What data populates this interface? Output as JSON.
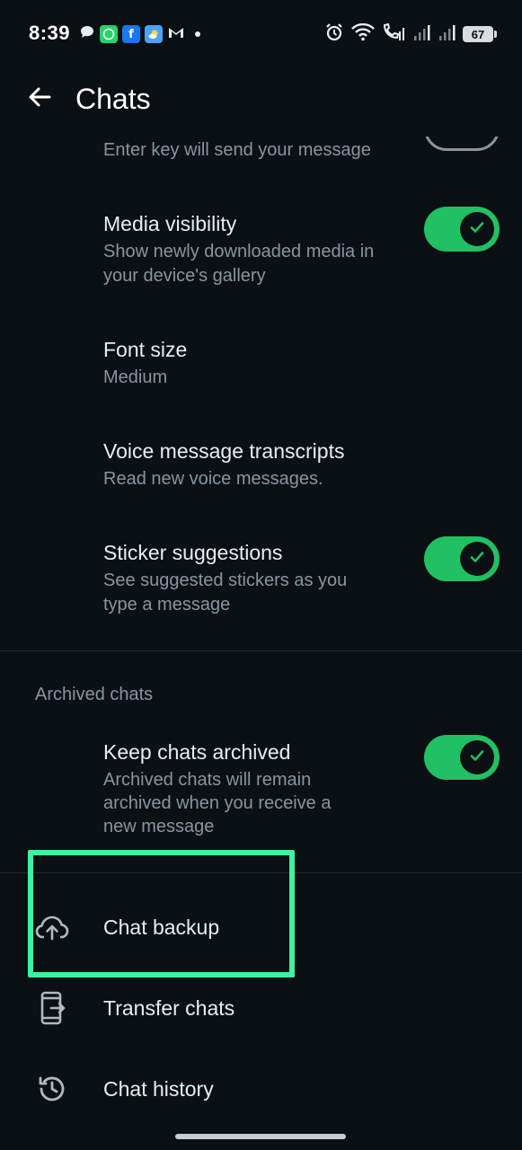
{
  "status_bar": {
    "time": "8:39",
    "battery": "67",
    "left_icons": [
      "chat-bubble-icon",
      "whatsapp-icon",
      "facebook-icon",
      "weather-icon",
      "gmail-icon"
    ],
    "right_icons": [
      "alarm-icon",
      "wifi-icon",
      "call-signal-icon",
      "signal-icon",
      "signal-icon",
      "battery-icon"
    ]
  },
  "header": {
    "title": "Chats"
  },
  "settings": {
    "enter_is_send": {
      "subtitle": "Enter key will send your message"
    },
    "media_visibility": {
      "title": "Media visibility",
      "subtitle_line1": "Show newly downloaded media in",
      "subtitle_line2": "your device's gallery",
      "enabled": true
    },
    "font_size": {
      "title": "Font size",
      "value": "Medium"
    },
    "voice_transcripts": {
      "title": "Voice message transcripts",
      "subtitle": "Read new voice messages."
    },
    "sticker_suggestions": {
      "title": "Sticker suggestions",
      "subtitle_line1": "See suggested stickers as you",
      "subtitle_line2": "type a message",
      "enabled": true
    }
  },
  "archived": {
    "section_title": "Archived chats",
    "keep_archived": {
      "title": "Keep chats archived",
      "subtitle_line1": "Archived chats will remain",
      "subtitle_line2": "archived when you receive a",
      "subtitle_line3": "new message",
      "enabled": true
    }
  },
  "actions": {
    "chat_backup": "Chat backup",
    "transfer_chats": "Transfer chats",
    "chat_history": "Chat history"
  },
  "colors": {
    "background": "#0b1014",
    "accent_green": "#21c063",
    "highlight": "#3ff2a0",
    "secondary_text": "#8696a0"
  }
}
